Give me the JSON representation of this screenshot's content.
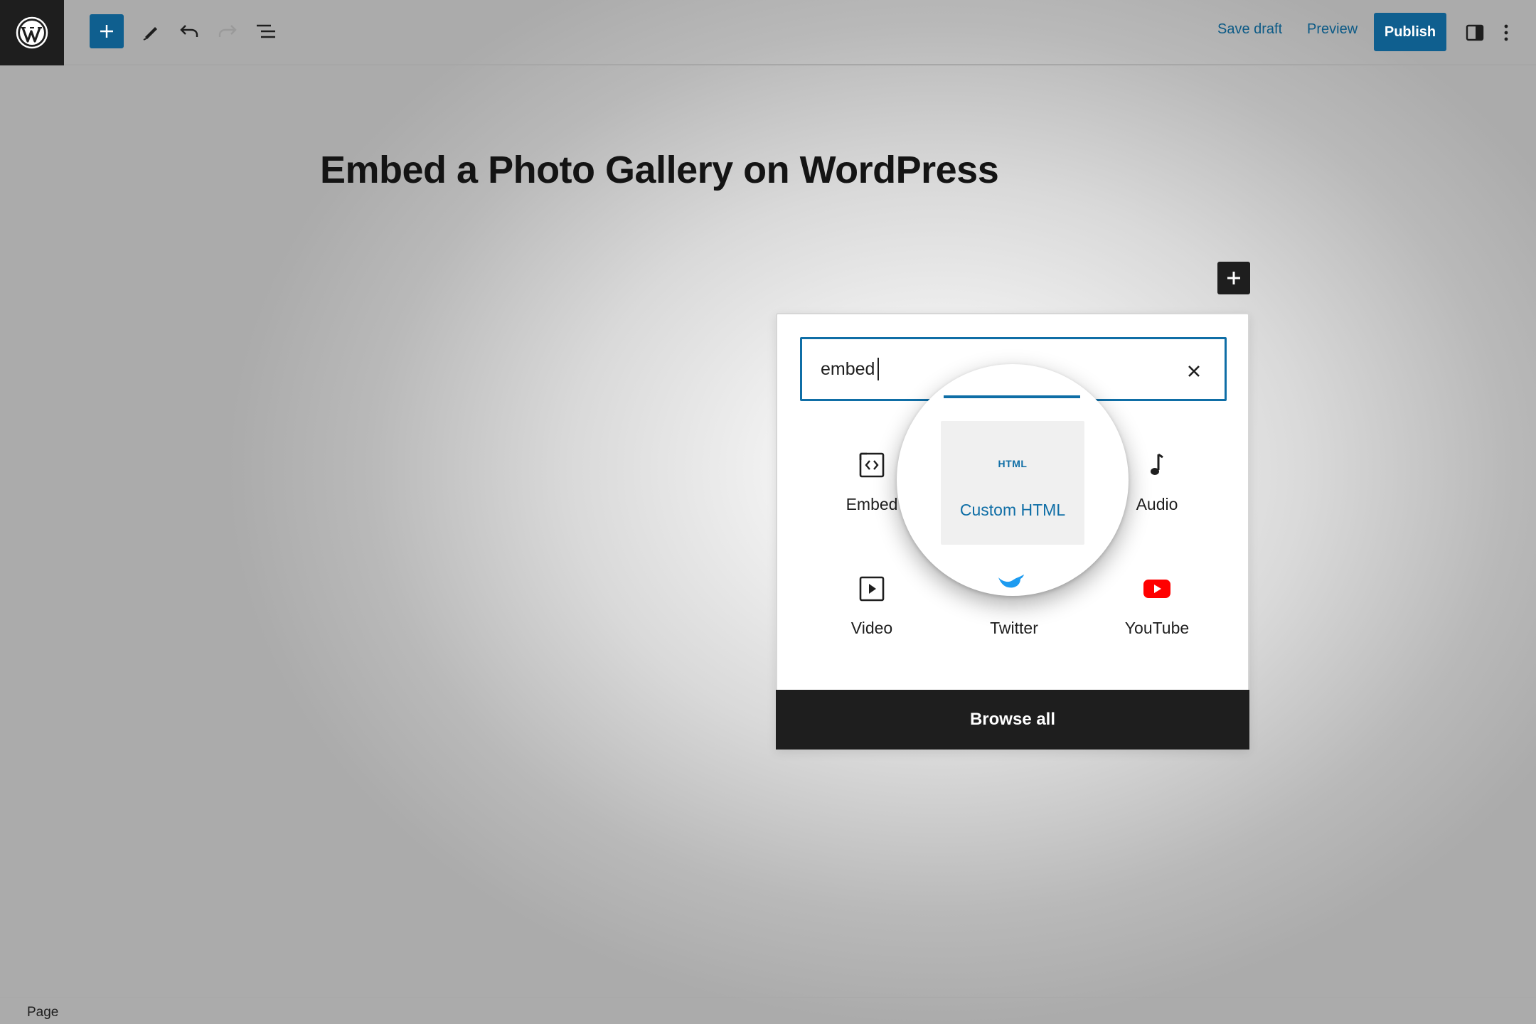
{
  "toolbar": {
    "logo_icon": "wordpress-logo",
    "add_icon": "plus-icon",
    "tools_icon": "pen-icon",
    "undo_icon": "undo-icon",
    "redo_icon": "redo-icon",
    "list_view_icon": "list-view-icon",
    "save_draft_label": "Save draft",
    "preview_label": "Preview",
    "publish_label": "Publish",
    "settings_icon": "sidebar-toggle-icon",
    "more_icon": "more-vertical-icon"
  },
  "editor": {
    "post_title": "Embed a Photo Gallery on WordPress"
  },
  "inserter": {
    "search_value": "embed",
    "clear_icon": "close-icon",
    "blocks": [
      {
        "label": "Embed",
        "icon": "embed-code-icon"
      },
      {
        "label": "Custom HTML",
        "icon": "html-icon",
        "icon_text": "HTML",
        "highlighted": true
      },
      {
        "label": "Audio",
        "icon": "music-note-icon"
      },
      {
        "label": "Video",
        "icon": "video-play-icon"
      },
      {
        "label": "Twitter",
        "icon": "twitter-bird-icon"
      },
      {
        "label": "YouTube",
        "icon": "youtube-icon"
      }
    ],
    "browse_all_label": "Browse all"
  },
  "status_bar": {
    "breadcrumb": "Page"
  },
  "colors": {
    "accent": "#0f6ea6",
    "publish_bg": "#0f5f8f",
    "dark": "#1e1e1e",
    "twitter": "#1d9bf0",
    "youtube": "#ff0000"
  }
}
